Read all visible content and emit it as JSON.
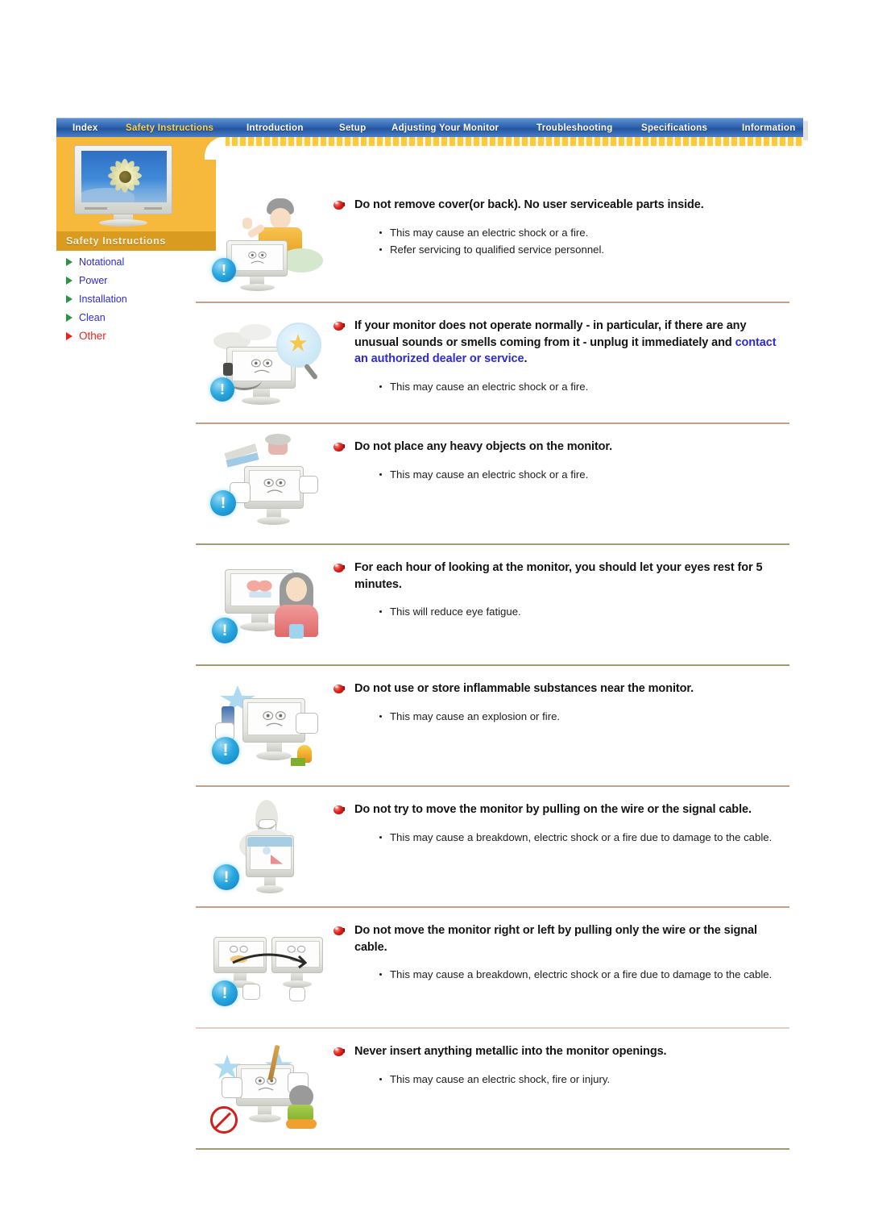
{
  "nav": {
    "items": [
      {
        "label": "Index",
        "active": false
      },
      {
        "label": "Safety Instructions",
        "active": true
      },
      {
        "label": "Introduction",
        "active": false
      },
      {
        "label": "Setup",
        "active": false
      },
      {
        "label": "Adjusting Your Monitor",
        "active": false
      },
      {
        "label": "Troubleshooting",
        "active": false
      },
      {
        "label": "Specifications",
        "active": false
      },
      {
        "label": "Information",
        "active": false
      }
    ]
  },
  "sidebar": {
    "thumbnail_alt": "monitor-thumbnail",
    "title": "Safety Instructions",
    "items": [
      {
        "label": "Notational",
        "selected": false
      },
      {
        "label": "Power",
        "selected": false
      },
      {
        "label": "Installation",
        "selected": false
      },
      {
        "label": "Clean",
        "selected": false
      },
      {
        "label": "Other",
        "selected": true
      }
    ]
  },
  "colors": {
    "nav_bg": "#2f64ae",
    "nav_active_text": "#ffd24d",
    "accent_yellow": "#f6b93b",
    "sidebar_title_bg": "#d99b20",
    "link_blue": "#2b2bd8",
    "selected_red": "#e8241b",
    "divider_brown": "#c4a08a",
    "divider_olive": "#a39a77",
    "badge_blue": "#2aa8e0",
    "bullet_red": "#e0231c"
  },
  "sections": [
    {
      "illustration": "man-removing-monitor-cover-icon",
      "heading": "Do not remove cover(or back). No user serviceable parts inside.",
      "heading_link": "",
      "heading_tail": "",
      "bullets": [
        "This may cause an electric shock or a fire.",
        "Refer servicing to qualified service personnel."
      ]
    },
    {
      "illustration": "monitor-smoke-magnifier-icon",
      "heading": "If your monitor does not operate normally - in particular, if there are any unusual sounds or smells coming from it - unplug it immediately and ",
      "heading_link": "contact an authorized dealer or service",
      "heading_tail": ".",
      "bullets": [
        "This may cause an electric shock or a fire."
      ]
    },
    {
      "illustration": "heavy-objects-on-monitor-icon",
      "heading": "Do not place any heavy objects on the monitor.",
      "heading_link": "",
      "heading_tail": "",
      "bullets": [
        "This may cause an electric shock or a fire."
      ]
    },
    {
      "illustration": "woman-resting-eyes-icon",
      "heading": "For each hour of looking at the monitor, you should let your eyes rest for 5 minutes.",
      "heading_link": "",
      "heading_tail": "",
      "bullets": [
        "This will reduce eye fatigue."
      ]
    },
    {
      "illustration": "inflammable-substances-near-monitor-icon",
      "heading": "Do not use or store inflammable substances near the monitor.",
      "heading_link": "",
      "heading_tail": "",
      "bullets": [
        "This may cause an explosion or fire."
      ]
    },
    {
      "illustration": "pulling-monitor-by-cable-icon",
      "heading": "Do not try to move the monitor by pulling on the wire or the signal cable.",
      "heading_link": "",
      "heading_tail": "",
      "bullets": [
        "This may cause a breakdown, electric shock or a fire due to damage to the cable."
      ]
    },
    {
      "illustration": "moving-monitor-sideways-by-cable-icon",
      "heading": "Do not move the monitor right or left by pulling only the wire or the signal cable.",
      "heading_link": "",
      "heading_tail": "",
      "bullets": [
        "This may cause a breakdown, electric shock or a fire due to damage to the cable."
      ]
    },
    {
      "illustration": "metallic-object-into-monitor-openings-icon",
      "heading": "Never insert anything metallic into the monitor openings.",
      "heading_link": "",
      "heading_tail": "",
      "bullets": [
        "This may cause an electric shock, fire or injury."
      ]
    }
  ]
}
